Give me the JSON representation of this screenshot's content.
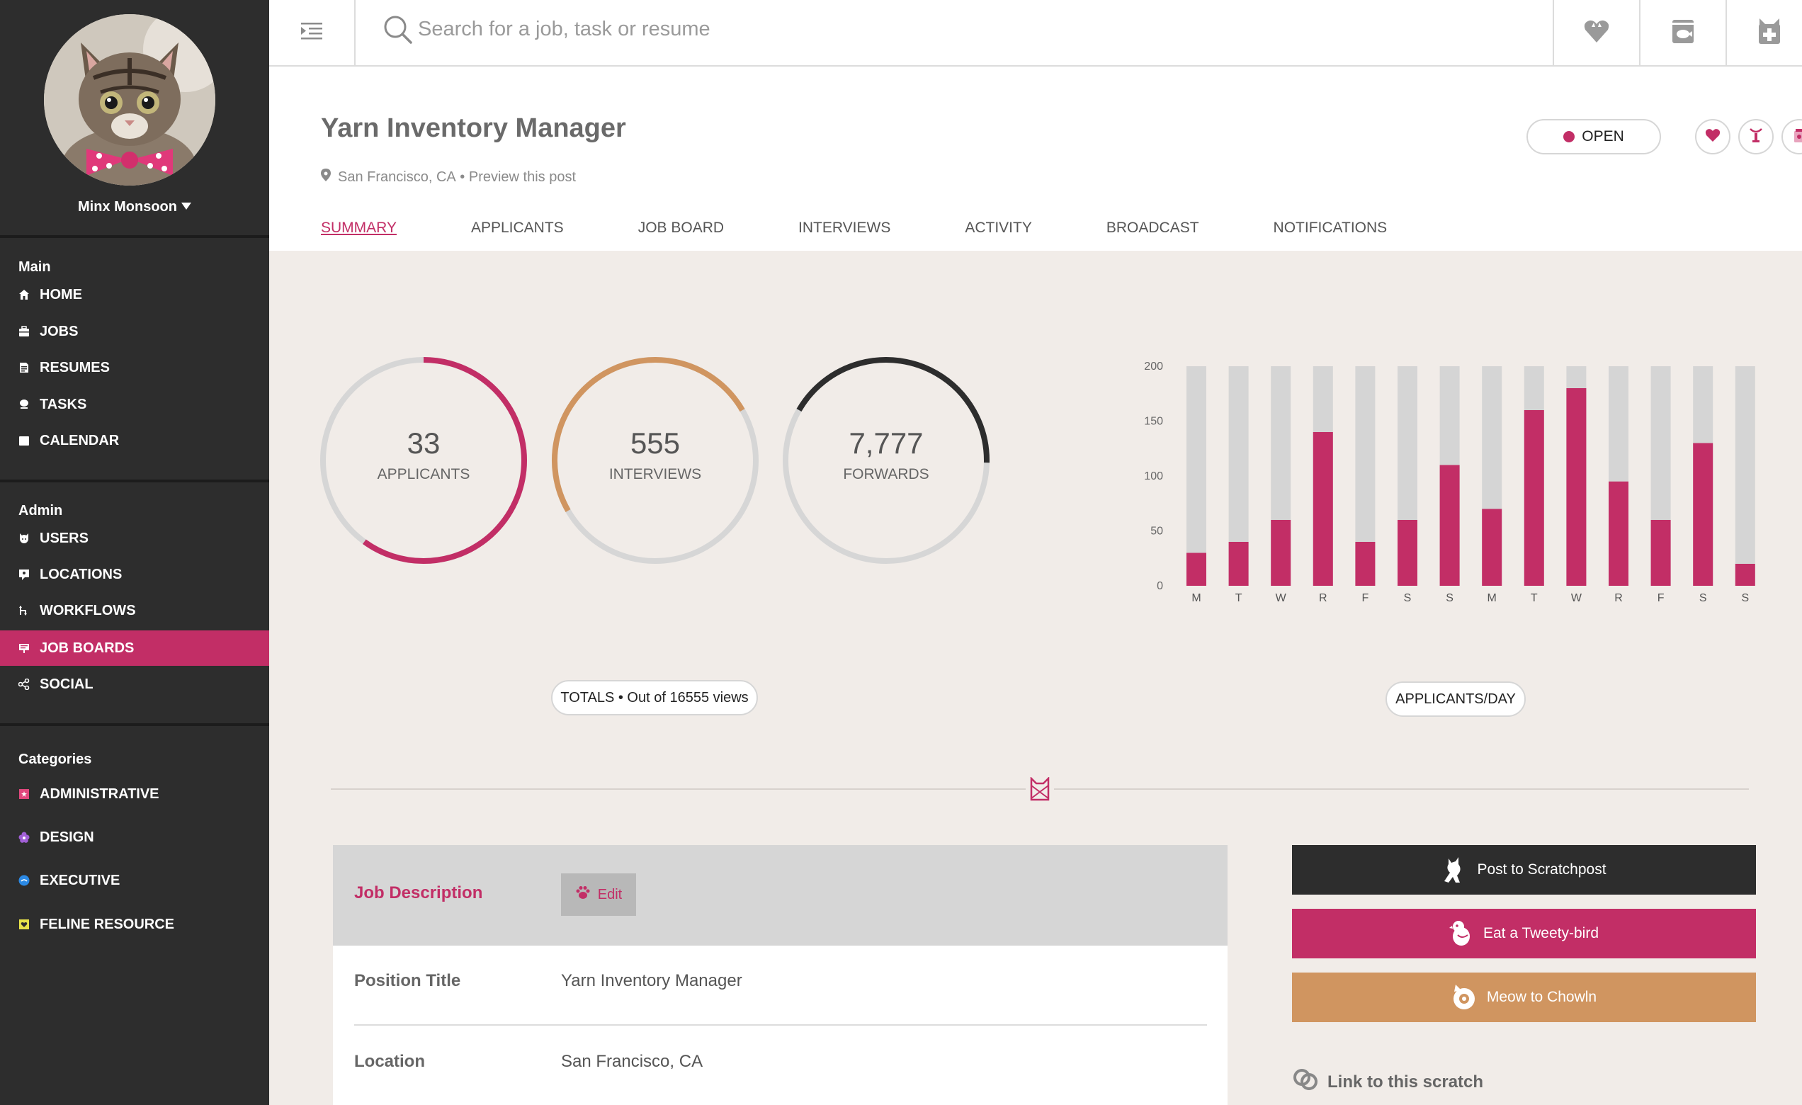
{
  "user": {
    "name": "Minx Monsoon"
  },
  "nav": {
    "sections": [
      {
        "title": "Main",
        "items": [
          {
            "label": "HOME",
            "icon": "home-icon"
          },
          {
            "label": "JOBS",
            "icon": "briefcase-icon"
          },
          {
            "label": "RESUMES",
            "icon": "document-icon"
          },
          {
            "label": "TASKS",
            "icon": "paw-icon"
          },
          {
            "label": "CALENDAR",
            "icon": "calendar-icon"
          }
        ]
      },
      {
        "title": "Admin",
        "items": [
          {
            "label": "USERS",
            "icon": "cat-face-icon"
          },
          {
            "label": "LOCATIONS",
            "icon": "map-pin-icon"
          },
          {
            "label": "WORKFLOWS",
            "icon": "workflow-icon"
          },
          {
            "label": "JOB BOARDS",
            "icon": "board-icon",
            "active": true
          },
          {
            "label": "SOCIAL",
            "icon": "share-icon"
          }
        ]
      },
      {
        "title": "Categories",
        "items": [
          {
            "label": "ADMINISTRATIVE",
            "icon": "square-pink-icon",
            "color": "#e0487d"
          },
          {
            "label": "DESIGN",
            "icon": "flower-purple-icon",
            "color": "#a15fd6"
          },
          {
            "label": "EXECUTIVE",
            "icon": "circle-blue-icon",
            "color": "#2b8ae6"
          },
          {
            "label": "FELINE RESOURCE",
            "icon": "heart-box-yellow-icon",
            "color": "#e8e34a"
          }
        ]
      }
    ]
  },
  "search": {
    "placeholder": "Search for a job, task or resume"
  },
  "job": {
    "title": "Yarn Inventory Manager",
    "location": "San Francisco, CA",
    "meta_separator": " • ",
    "preview_link": "Preview this post",
    "status": "OPEN",
    "tabs": [
      "SUMMARY",
      "APPLICANTS",
      "JOB BOARD",
      "INTERVIEWS",
      "ACTIVITY",
      "BROADCAST",
      "NOTIFICATIONS"
    ],
    "active_tab": "SUMMARY"
  },
  "stats": [
    {
      "value": "33",
      "label": "APPLICANTS",
      "color": "#c22e66",
      "fraction": 0.6
    },
    {
      "value": "555",
      "label": "INTERVIEWS",
      "color": "#d09560",
      "fraction": 0.5
    },
    {
      "value": "7,777",
      "label": "FORWARDS",
      "color": "#2d2d2d",
      "fraction": 0.42
    }
  ],
  "totals_pill": "TOTALS • Out of 16555 views",
  "chart_pill": "APPLICANTS/DAY",
  "chart_data": {
    "type": "bar",
    "categories": [
      "M",
      "T",
      "W",
      "R",
      "F",
      "S",
      "S",
      "M",
      "T",
      "W",
      "R",
      "F",
      "S",
      "S"
    ],
    "values": [
      30,
      40,
      60,
      140,
      40,
      60,
      110,
      70,
      160,
      180,
      95,
      60,
      130,
      20
    ],
    "max_values": [
      200,
      200,
      200,
      200,
      200,
      200,
      200,
      200,
      200,
      200,
      200,
      200,
      200,
      200
    ],
    "ylim": [
      0,
      200
    ],
    "yticks": [
      0,
      50,
      100,
      150,
      200
    ],
    "colors": {
      "value": "#c22e66",
      "track": "#d5d5d5"
    },
    "title": "",
    "xlabel": "",
    "ylabel": ""
  },
  "job_description": {
    "title": "Job Description",
    "edit_label": "Edit",
    "rows": [
      {
        "label": "Position Title",
        "value": "Yarn Inventory Manager"
      },
      {
        "label": "Location",
        "value": "San Francisco, CA"
      }
    ]
  },
  "share": {
    "buttons": [
      {
        "label": "Post to Scratchpost",
        "color": "#2d2d2d",
        "icon": "cat-jump-icon"
      },
      {
        "label": "Eat a Tweety-bird",
        "color": "#c22e66",
        "icon": "bird-icon"
      },
      {
        "label": "Meow to Chowln",
        "color": "#d09560",
        "icon": "chowln-icon"
      }
    ],
    "link_label": "Link to this scratch"
  },
  "theme": {
    "accent": "#c22e66",
    "sidebar_bg": "#2d2d2d",
    "content_bg": "#f1ece8"
  }
}
